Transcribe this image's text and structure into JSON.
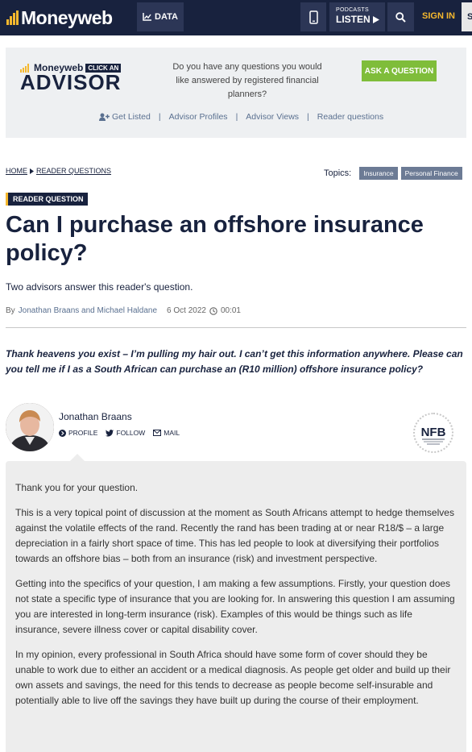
{
  "nav": {
    "logo": "Moneyweb",
    "data_label": "DATA",
    "podcasts_small": "PODCASTS",
    "podcasts_big": "LISTEN",
    "signin": "SIGN IN",
    "subscribe_edge": "S"
  },
  "advisor_banner": {
    "logo_top": "Moneyweb",
    "logo_tag": "CLICK AN",
    "logo_big": "ADVISOR",
    "question": "Do you have any questions you would like answered by registered financial planners?",
    "ask_button": "ASK A QUESTION",
    "links": [
      "Get Listed",
      "Advisor Profiles",
      "Advisor Views",
      "Reader questions"
    ]
  },
  "breadcrumb": {
    "home": "HOME",
    "section": "READER QUESTIONS"
  },
  "topics": {
    "label": "Topics:",
    "tags": [
      "Insurance",
      "Personal Finance"
    ]
  },
  "article": {
    "badge": "READER QUESTION",
    "title": "Can I purchase an offshore insurance policy?",
    "subtitle": "Two advisors answer this reader's question.",
    "byline_prefix": "By",
    "authors": "Jonathan Braans and Michael Haldane",
    "date": "6 Oct 2022",
    "time": "00:01",
    "question": "Thank heavens you exist – I’m pulling my hair out. I can’t get this information anywhere. Please can you tell me if I as a South African can purchase an (R10 million) offshore insurance policy?"
  },
  "advisor": {
    "name": "Jonathan Braans",
    "profile": "PROFILE",
    "follow": "FOLLOW",
    "mail": "MAIL",
    "badge_text": "NFB"
  },
  "answer": {
    "paragraphs": [
      "Thank you for your question.",
      "This is a very topical point of discussion at the moment as South Africans attempt to hedge themselves against the volatile effects of the rand. Recently the rand has been trading at or near R18/$ – a large depreciation in a fairly short space of time. This has led people to look at diversifying their portfolios towards an offshore bias – both from an insurance (risk) and investment perspective.",
      "Getting into the specifics of your question, I am making a few assumptions. Firstly, your question does not state a specific type of insurance that you are looking for. In answering this question I am assuming you are interested in long-term insurance (risk). Examples of this would be things such as life insurance, severe illness cover or capital disability cover.",
      "In my opinion, every professional in South Africa should have some form of cover should they be unable to work due to either an accident or a medical diagnosis. As people get older and build up their own assets and savings, the need for this tends to decrease as people become self-insurable and potentially able to live off the savings they have built up during the course of their employment."
    ]
  },
  "colors": {
    "navy": "#18223e",
    "accent": "#f5b82e",
    "green": "#7fbd3a",
    "tag": "#6c7b95"
  }
}
